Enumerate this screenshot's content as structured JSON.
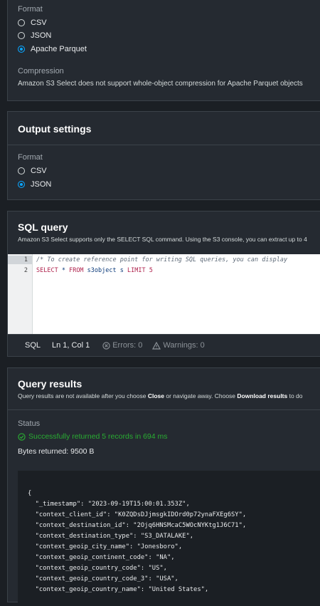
{
  "input_panel": {
    "format_label": "Format",
    "format_options": [
      "CSV",
      "JSON",
      "Apache Parquet"
    ],
    "compression_label": "Compression",
    "compression_text": "Amazon S3 Select does not support whole-object compression for Apache Parquet objects"
  },
  "output_panel": {
    "title": "Output settings",
    "format_label": "Format",
    "format_options": [
      "CSV",
      "JSON"
    ]
  },
  "sql_panel": {
    "title": "SQL query",
    "description": "Amazon S3 Select supports only the SELECT SQL command. Using the S3 console, you can extract up to 4",
    "line_numbers": [
      "1",
      "2"
    ],
    "code_line_1": "/* To create reference point for writing SQL queries, you can display",
    "code_line_2_kw1": "SELECT",
    "code_line_2_star": " * ",
    "code_line_2_kw2": "FROM",
    "code_line_2_rest": " s3object s ",
    "code_line_2_kw3": "LIMIT",
    "code_line_2_num": " 5",
    "status_lang": "SQL",
    "status_pos": "Ln 1, Col 1",
    "status_errors": "Errors: 0",
    "status_warnings": "Warnings: 0"
  },
  "results_panel": {
    "title": "Query results",
    "desc_pre": "Query results are not available after you choose ",
    "desc_close": "Close",
    "desc_mid": " or navigate away. Choose ",
    "desc_download": "Download results",
    "desc_post": " to do",
    "status_label": "Status",
    "status_text": "Successfully returned 5 records in 694 ms",
    "bytes_text": "Bytes returned: 9500 B",
    "json_lines": [
      "{",
      "  \"_timestamp\": \"2023-09-19T15:00:01.353Z\",",
      "  \"context_client_id\": \"K0ZQDsDJjmsgkIDOrd0p72ynaFXEg6SY\",",
      "  \"context_destination_id\": \"2Ojq6HNSMcaC5WOcNYKtg1J6C71\",",
      "  \"context_destination_type\": \"S3_DATALAKE\",",
      "  \"context_geoip_city_name\": \"Jonesboro\",",
      "  \"context_geoip_continent_code\": \"NA\",",
      "  \"context_geoip_country_code\": \"US\",",
      "  \"context_geoip_country_code_3\": \"USA\",",
      "  \"context_geoip_country_name\": \"United States\","
    ]
  },
  "colors": {
    "accent": "#0aa6ff",
    "success": "#29ad32"
  }
}
